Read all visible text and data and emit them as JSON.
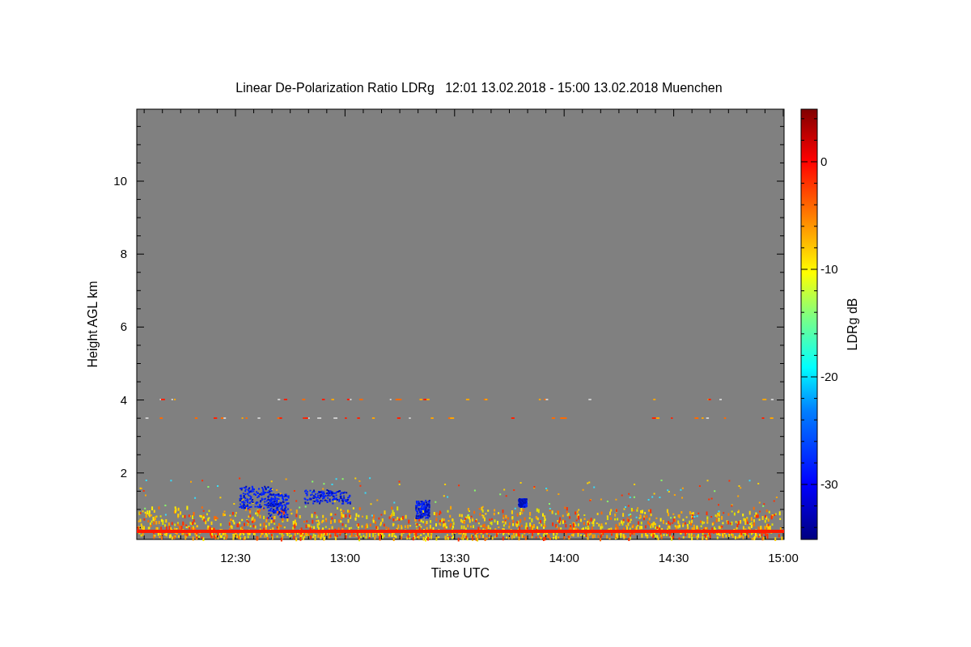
{
  "title": "Linear De-Polarization Ratio LDRg   12:01 13.02.2018 - 15:00 13.02.2018 Muenchen",
  "plot": {
    "ylabel": "Height AGL km",
    "yticks": [
      "10",
      "8",
      "6",
      "4",
      "2"
    ],
    "xlabel": "Time UTC",
    "xticks": [
      "12:30",
      "13:00",
      "13:30",
      "14:00",
      "14:30",
      "15:00"
    ]
  },
  "colorbar": {
    "label": "LDRg dB",
    "ticks": [
      "0",
      "-10",
      "-20",
      "-30"
    ]
  }
}
